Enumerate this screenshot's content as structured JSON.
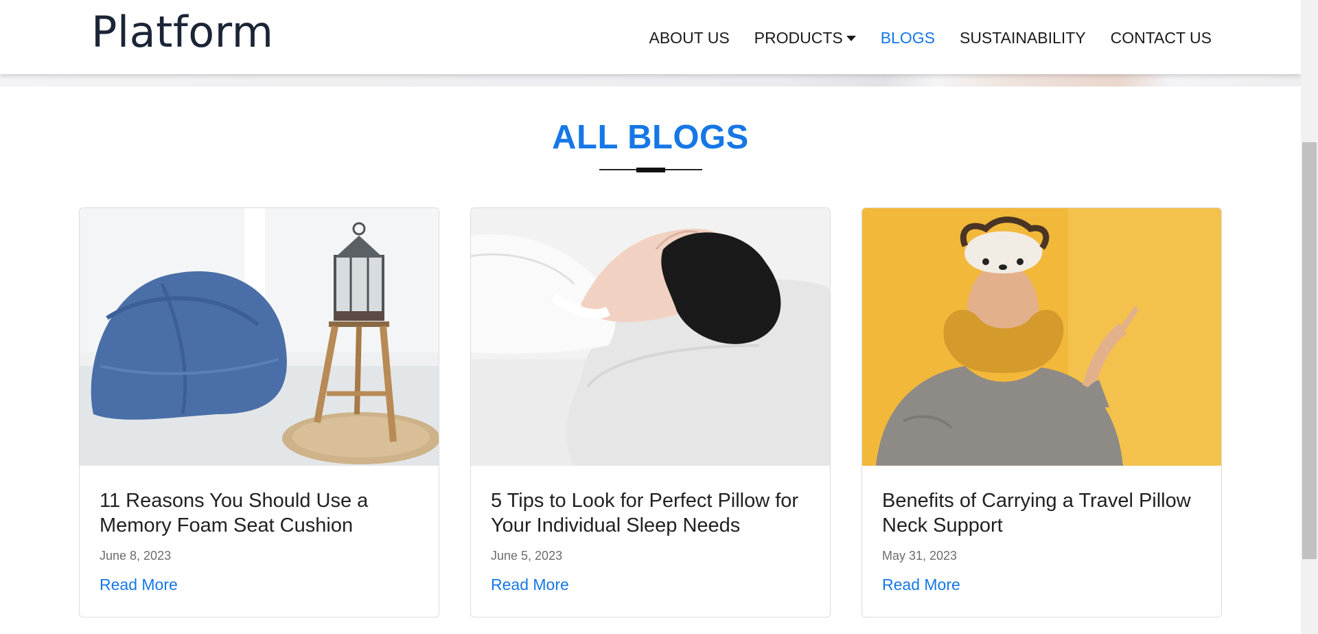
{
  "header": {
    "logo": "Platform",
    "nav": [
      {
        "label": "ABOUT US",
        "active": false,
        "dropdown": false
      },
      {
        "label": "PRODUCTS",
        "active": false,
        "dropdown": true
      },
      {
        "label": "BLOGS",
        "active": true,
        "dropdown": false
      },
      {
        "label": "SUSTAINABILITY",
        "active": false,
        "dropdown": false
      },
      {
        "label": "CONTACT US",
        "active": false,
        "dropdown": false
      }
    ]
  },
  "section": {
    "title": "ALL BLOGS"
  },
  "posts": [
    {
      "title": "11 Reasons You Should Use a Memory Foam Seat Cushion",
      "date": "June 8, 2023",
      "link": "Read More",
      "image": "blue-beanbag-lantern-stool"
    },
    {
      "title": "5 Tips to Look for Perfect Pillow for Your Individual Sleep Needs",
      "date": "June 5, 2023",
      "link": "Read More",
      "image": "woman-sleeping-on-pillow"
    },
    {
      "title": "Benefits of Carrying a Travel Pillow Neck Support",
      "date": "May 31, 2023",
      "link": "Read More",
      "image": "man-with-travel-neck-pillow"
    }
  ],
  "colors": {
    "accent": "#1677e6",
    "text": "#212121",
    "logo": "#1b2536",
    "card_border": "#dcdcdc"
  }
}
